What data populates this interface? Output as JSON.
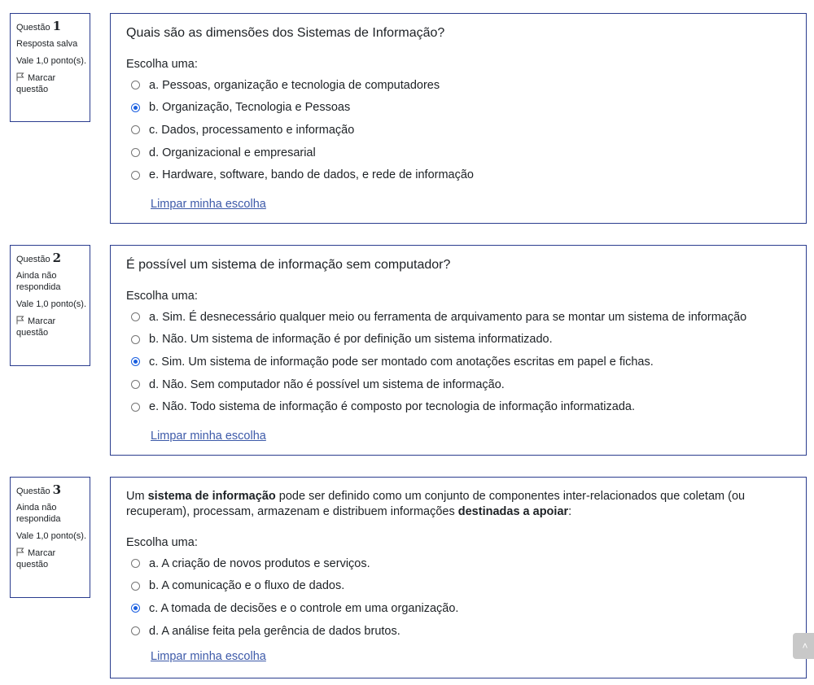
{
  "labels": {
    "question_prefix": "Questão",
    "prompt": "Escolha uma:",
    "clear_choice": "Limpar minha escolha",
    "flag": "Marcar questão",
    "scroll_top_icon": "chevron-up-icon"
  },
  "questions": [
    {
      "number": "1",
      "state": "Resposta salva",
      "grade": "Vale 1,0 ponto(s).",
      "text_parts": [
        "Quais são as dimensões dos Sistemas de Informação?"
      ],
      "options": [
        {
          "label": "a. Pessoas, organização e tecnologia de computadores",
          "checked": false
        },
        {
          "label": "b. Organização, Tecnologia e Pessoas",
          "checked": true
        },
        {
          "label": "c. Dados, processamento e informação",
          "checked": false
        },
        {
          "label": "d. Organizacional e empresarial",
          "checked": false
        },
        {
          "label": "e. Hardware, software, bando de dados, e rede de informação",
          "checked": false
        }
      ]
    },
    {
      "number": "2",
      "state": "Ainda não respondida",
      "grade": "Vale 1,0 ponto(s).",
      "text_parts": [
        "É possível um sistema de informação sem computador?"
      ],
      "options": [
        {
          "label": "a. Sim. É desnecessário qualquer meio ou ferramenta de arquivamento para se montar um sistema de informação",
          "checked": false
        },
        {
          "label": "b. Não. Um sistema de informação é por definição um sistema informatizado.",
          "checked": false
        },
        {
          "label": "c. Sim. Um sistema de informação pode ser montado com anotações escritas em papel e fichas.",
          "checked": true
        },
        {
          "label": "d. Não. Sem computador não é possível um sistema de informação.",
          "checked": false
        },
        {
          "label": "e. Não. Todo sistema de informação é composto por tecnologia de informação informatizada.",
          "checked": false
        }
      ]
    },
    {
      "number": "3",
      "state": "Ainda não respondida",
      "grade": "Vale 1,0 ponto(s).",
      "text_parts": [
        "Um ",
        "sistema de informação",
        " pode ser definido como um conjunto de componentes inter-relacionados que coletam (ou recuperam), processam, armazenam e distribuem informações ",
        "destinadas a apoiar",
        ":"
      ],
      "options": [
        {
          "label": "a. A criação de novos produtos e serviços.",
          "checked": false
        },
        {
          "label": "b. A comunicação e o fluxo de dados.",
          "checked": false
        },
        {
          "label": "c. A tomada de decisões e o controle em uma organização.",
          "checked": true
        },
        {
          "label": "d. A análise feita pela gerência de dados brutos.",
          "checked": false
        }
      ]
    }
  ],
  "colors": {
    "border": "#2a3c8e",
    "link": "#3d5aa9",
    "radio_checked": "#1a5fe0"
  }
}
